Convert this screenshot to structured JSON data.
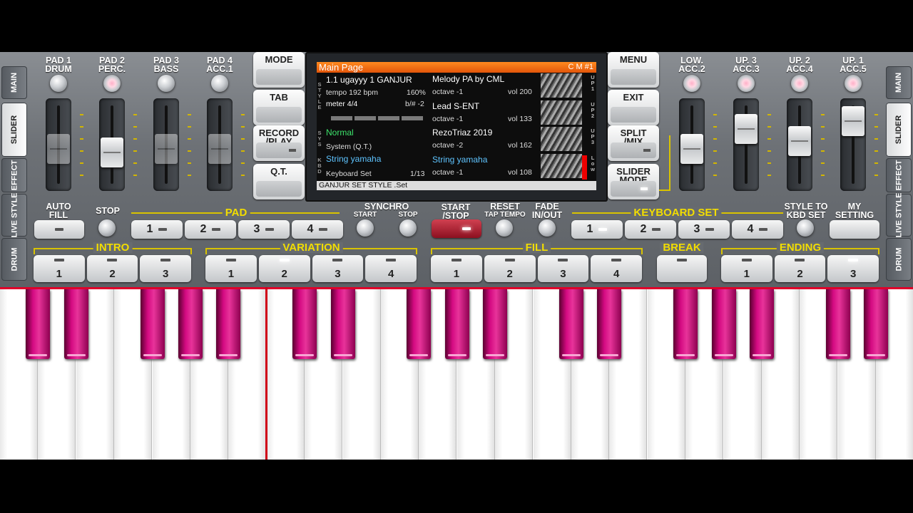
{
  "side_tabs_left": [
    "MAIN",
    "SLIDER",
    "EFFECT",
    "LIVE STYLE",
    "DRUM"
  ],
  "side_tabs_right": [
    "MAIN",
    "SLIDER",
    "EFFECT",
    "LIVE STYLE",
    "DRUM"
  ],
  "active_side_tab": "SLIDER",
  "left_channels": [
    {
      "label": "PAD 1\nDRUM",
      "level": 0.55,
      "knob": "white"
    },
    {
      "label": "PAD 2\nPERC.",
      "level": 0.5,
      "knob": "pink"
    },
    {
      "label": "PAD 3\nBASS",
      "level": 0.55,
      "knob": "white"
    },
    {
      "label": "PAD 4\nACC.1",
      "level": 0.55,
      "knob": "white"
    }
  ],
  "right_channels": [
    {
      "label": "LOW.\nACC.2",
      "level": 0.55,
      "knob": "pink"
    },
    {
      "label": "UP. 3\nACC.3",
      "level": 0.8,
      "knob": "pink"
    },
    {
      "label": "UP. 2\nACC.4",
      "level": 0.65,
      "knob": "pink"
    },
    {
      "label": "UP. 1\nACC.5",
      "level": 0.9,
      "knob": "pink"
    }
  ],
  "left_menu": [
    "MODE",
    "TAB",
    "RECORD\n/PLAY",
    "Q.T."
  ],
  "right_menu": [
    "MENU",
    "EXIT",
    "SPLIT\n/MIX",
    "SLIDER\nMODE"
  ],
  "lcd": {
    "title": "Main Page",
    "title_right": "C M #1",
    "style_name": "1.1 ugayyy 1 GANJUR",
    "tempo": "tempo 192 bpm",
    "tempo_pct": "160%",
    "meter": "meter 4/4",
    "transpose": "b/# -2",
    "sys_name": "Normal",
    "sys_sub": "System (Q.T.)",
    "kbd_name": "String yamaha",
    "kbd_sub": "Keyboard Set",
    "kbd_count": "1/13",
    "side_style": "S\nT\nY\nL\nE",
    "side_sys": "S\nY\nS",
    "side_kbd": "K\nB\nD",
    "voices": [
      {
        "name": "Melody PA by CML",
        "octave": "octave -1",
        "vol": "vol 200",
        "tag": "U\nP\n1"
      },
      {
        "name": "Lead S-ENT",
        "octave": "octave -1",
        "vol": "vol 133",
        "tag": "U\nP\n2"
      },
      {
        "name": "RezoTriaz 2019",
        "octave": "octave -2",
        "vol": "vol 162",
        "tag": "U\nP\n3"
      },
      {
        "name": "String yamaha",
        "octave": "octave -1",
        "vol": "vol 108",
        "tag": "L\no\nw"
      }
    ],
    "footer": "GANJUR SET STYLE .Set"
  },
  "row1": {
    "auto_fill": "AUTO\nFILL",
    "stop": "STOP",
    "pad_group": "PAD",
    "pads": [
      "1",
      "2",
      "3",
      "4"
    ],
    "synchro": "SYNCHRO",
    "synchro_start": "START",
    "synchro_stop": "STOP",
    "start_stop": "START\n/STOP",
    "reset": "RESET",
    "tap_tempo": "TAP TEMPO",
    "fade": "FADE\nIN/OUT",
    "kbd_set_group": "KEYBOARD SET",
    "kbd_sets": [
      "1",
      "2",
      "3",
      "4"
    ],
    "style_to_kbd": "STYLE TO\nKBD SET",
    "my_setting": "MY\nSETTING"
  },
  "row2": {
    "intro": "INTRO",
    "intro_btns": [
      "1",
      "2",
      "3"
    ],
    "variation": "VARIATION",
    "variation_btns": [
      "1",
      "2",
      "3",
      "4"
    ],
    "fill": "FILL",
    "fill_btns": [
      "1",
      "2",
      "3",
      "4"
    ],
    "break": "BREAK",
    "ending": "ENDING",
    "ending_btns": [
      "1",
      "2",
      "3"
    ]
  },
  "colors": {
    "accent": "#f2dd00",
    "lcd_title": "#e2550a",
    "keys_black": "#d40a82",
    "marker": "#d00018"
  }
}
